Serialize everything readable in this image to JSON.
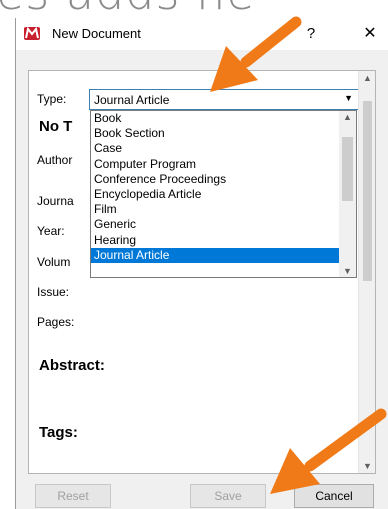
{
  "background_text": "es adds ne",
  "dialog": {
    "title": "New Document",
    "help_label": "?",
    "close_label": "✕"
  },
  "form": {
    "type_label": "Type:",
    "type_value": "Journal Article",
    "title_heading": "No T",
    "author_label": "Author",
    "journal_label": "Journa",
    "year_label": "Year:",
    "volume_label": "Volum",
    "issue_label": "Issue:",
    "pages_label": "Pages:",
    "abstract_heading": "Abstract:",
    "tags_heading": "Tags:"
  },
  "dropdown": {
    "options": [
      "Book",
      "Book Section",
      "Case",
      "Computer Program",
      "Conference Proceedings",
      "Encyclopedia Article",
      "Film",
      "Generic",
      "Hearing",
      "Journal Article"
    ],
    "selected": "Journal Article"
  },
  "buttons": {
    "reset": "Reset",
    "save": "Save",
    "cancel": "Cancel"
  },
  "colors": {
    "arrow": "#f07a18",
    "selection": "#0078d7",
    "brand": "#c8202f"
  }
}
